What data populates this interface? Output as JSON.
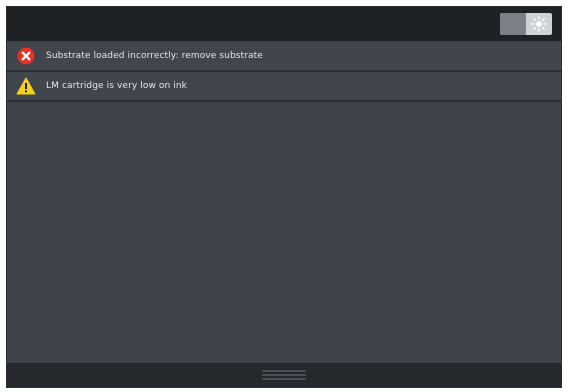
{
  "header": {
    "toggle_icon": "brightness-icon"
  },
  "alerts": [
    {
      "severity": "error",
      "icon": "error-circle-x-icon",
      "color": "#e5312b",
      "text": "Substrate loaded incorrectly: remove substrate"
    },
    {
      "severity": "warning",
      "icon": "warning-triangle-icon",
      "color": "#f2d21b",
      "text": "LM cartridge is very low on ink"
    }
  ],
  "footer": {
    "handle_icon": "drag-handle-icon"
  }
}
